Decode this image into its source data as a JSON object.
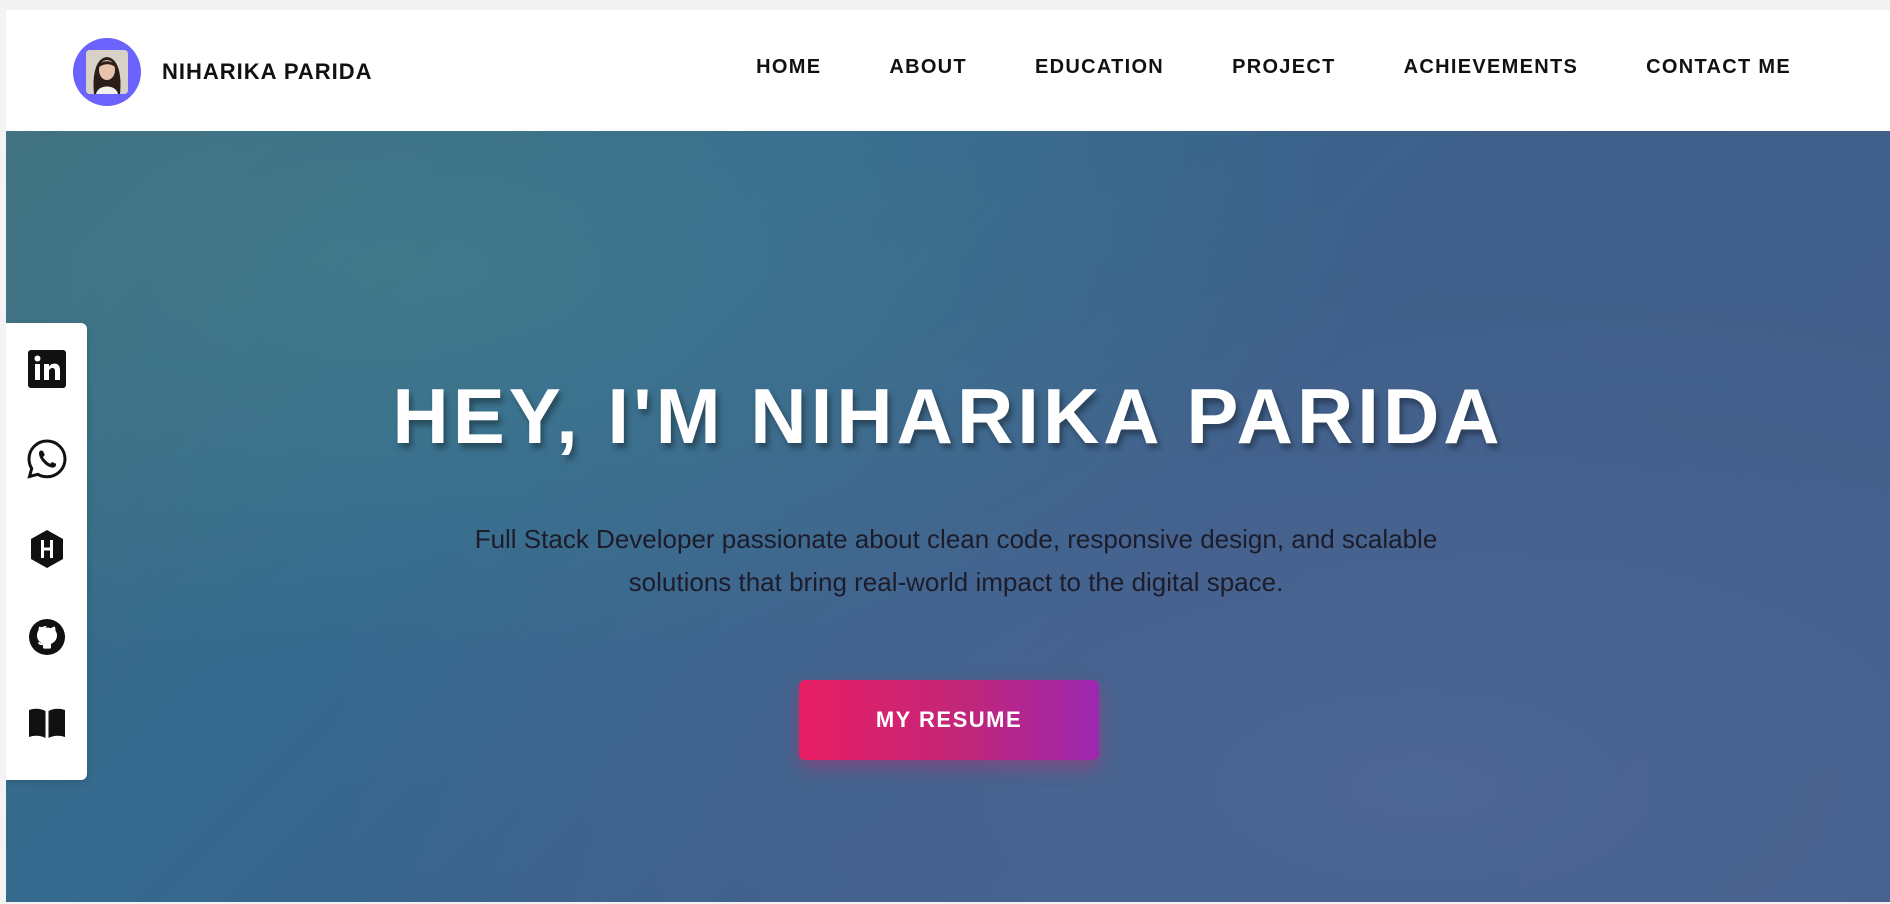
{
  "brand": {
    "name": "NIHARIKA PARIDA",
    "avatar_color": "#6c63ff"
  },
  "nav": {
    "items": [
      {
        "label": "HOME"
      },
      {
        "label": "ABOUT"
      },
      {
        "label": "EDUCATION"
      },
      {
        "label": "PROJECT"
      },
      {
        "label": "ACHIEVEMENTS"
      },
      {
        "label": "CONTACT ME"
      }
    ]
  },
  "hero": {
    "title": "HEY, I'M NIHARIKA PARIDA",
    "subtitle": "Full Stack Developer passionate about clean code, responsive design, and scalable solutions that bring real-world impact to the digital space.",
    "button_label": "MY RESUME",
    "button_gradient": [
      "#e91e63",
      "#9c27b0"
    ]
  },
  "social": {
    "icons": [
      "linkedin-icon",
      "whatsapp-icon",
      "hackerrank-icon",
      "github-icon",
      "book-icon"
    ]
  }
}
